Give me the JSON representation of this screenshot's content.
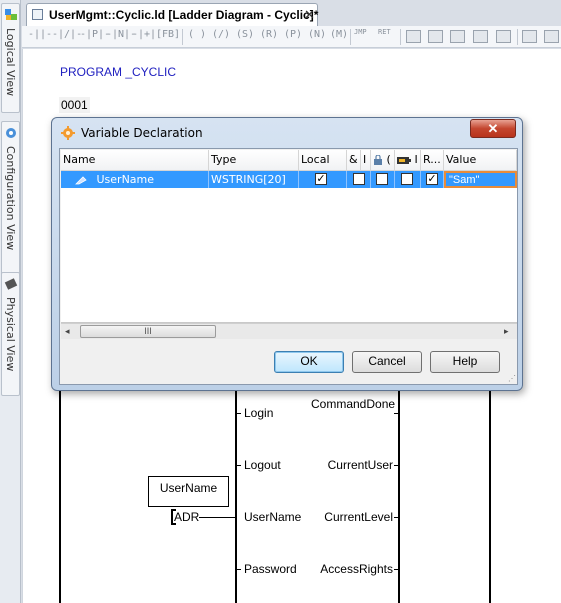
{
  "sidebar": {
    "views": [
      {
        "label": "Logical View",
        "icon": "logical-view-icon"
      },
      {
        "label": "Configuration View",
        "icon": "configuration-view-icon"
      },
      {
        "label": "Physical View",
        "icon": "physical-view-icon"
      }
    ]
  },
  "editor_tab": {
    "title": "UserMgmt::Cyclic.ld [Ladder Diagram - Cyclic]*",
    "close": "✕"
  },
  "toolbar": {
    "labels": [
      "JMP",
      "RET"
    ]
  },
  "editor": {
    "program_title": "PROGRAM _CYCLIC",
    "network_number": "0001",
    "block_inputs": [
      "Login",
      "Logout",
      "UserName",
      "Password"
    ],
    "block_outputs": [
      "CommandDone",
      "CurrentUser",
      "CurrentLevel",
      "AccessRights"
    ],
    "variable_box": "UserName",
    "adr_label": "ADR"
  },
  "dialog": {
    "title": "Variable Declaration",
    "close": "✕",
    "columns": [
      "Name",
      "Type",
      "Local",
      "&",
      "I",
      "(",
      "I",
      "R...",
      "Value"
    ],
    "row": {
      "name": "UserName",
      "type": "WSTRING[20]",
      "value": "\"Sam\"",
      "local_checked": true,
      "retain_checked": true
    },
    "scroll_thumb": "III",
    "buttons": {
      "ok": "OK",
      "cancel": "Cancel",
      "help": "Help"
    }
  }
}
